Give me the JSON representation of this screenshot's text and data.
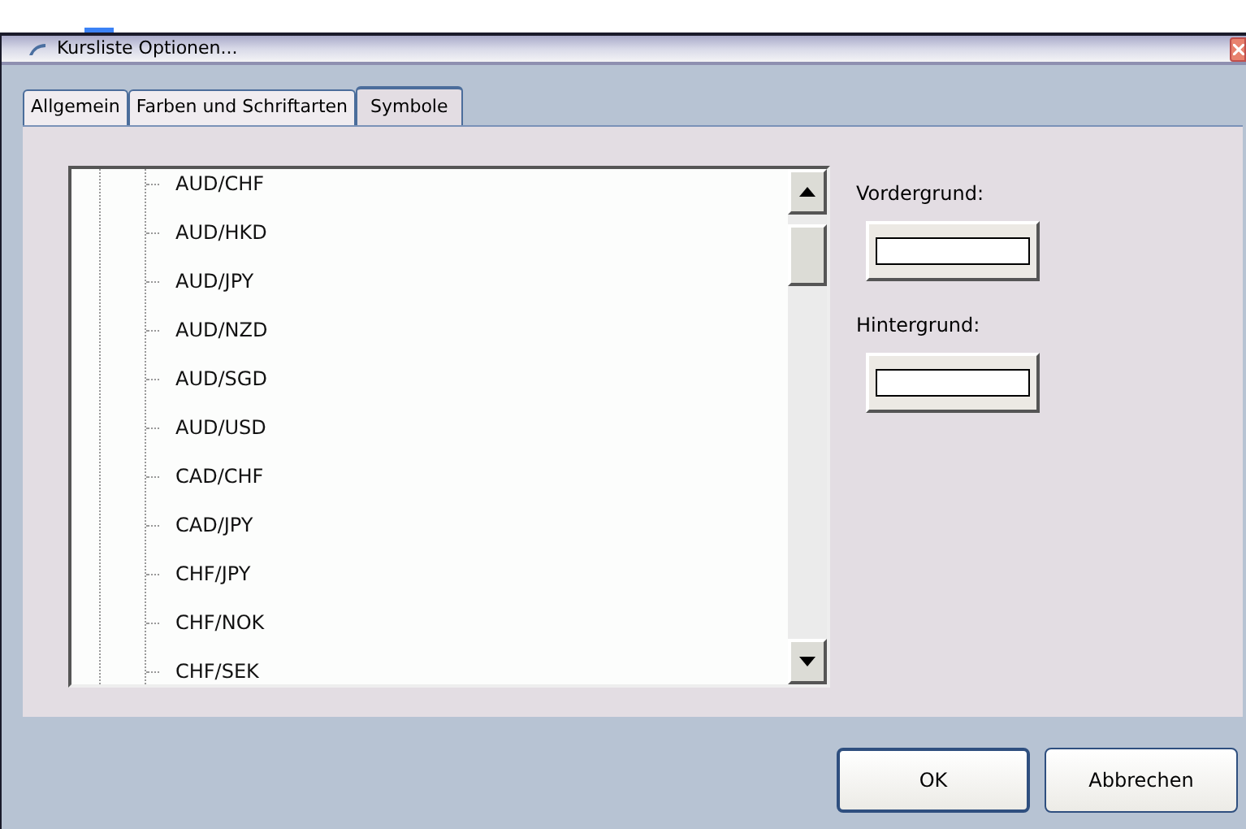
{
  "window": {
    "title": "Kursliste Optionen..."
  },
  "tabs": [
    {
      "label": "Allgemein",
      "selected": false
    },
    {
      "label": "Farben und Schriftarten",
      "selected": false
    },
    {
      "label": "Symbole",
      "selected": true
    }
  ],
  "symbols": [
    "AUD/CHF",
    "AUD/HKD",
    "AUD/JPY",
    "AUD/NZD",
    "AUD/SGD",
    "AUD/USD",
    "CAD/CHF",
    "CAD/JPY",
    "CHF/JPY",
    "CHF/NOK",
    "CHF/SEK"
  ],
  "color_pickers": [
    {
      "label": "Vordergrund:"
    },
    {
      "label": "Hintergrund:"
    }
  ],
  "buttons": [
    {
      "label": "OK",
      "kind": "default"
    },
    {
      "label": "Abbrechen",
      "kind": "normal"
    }
  ]
}
